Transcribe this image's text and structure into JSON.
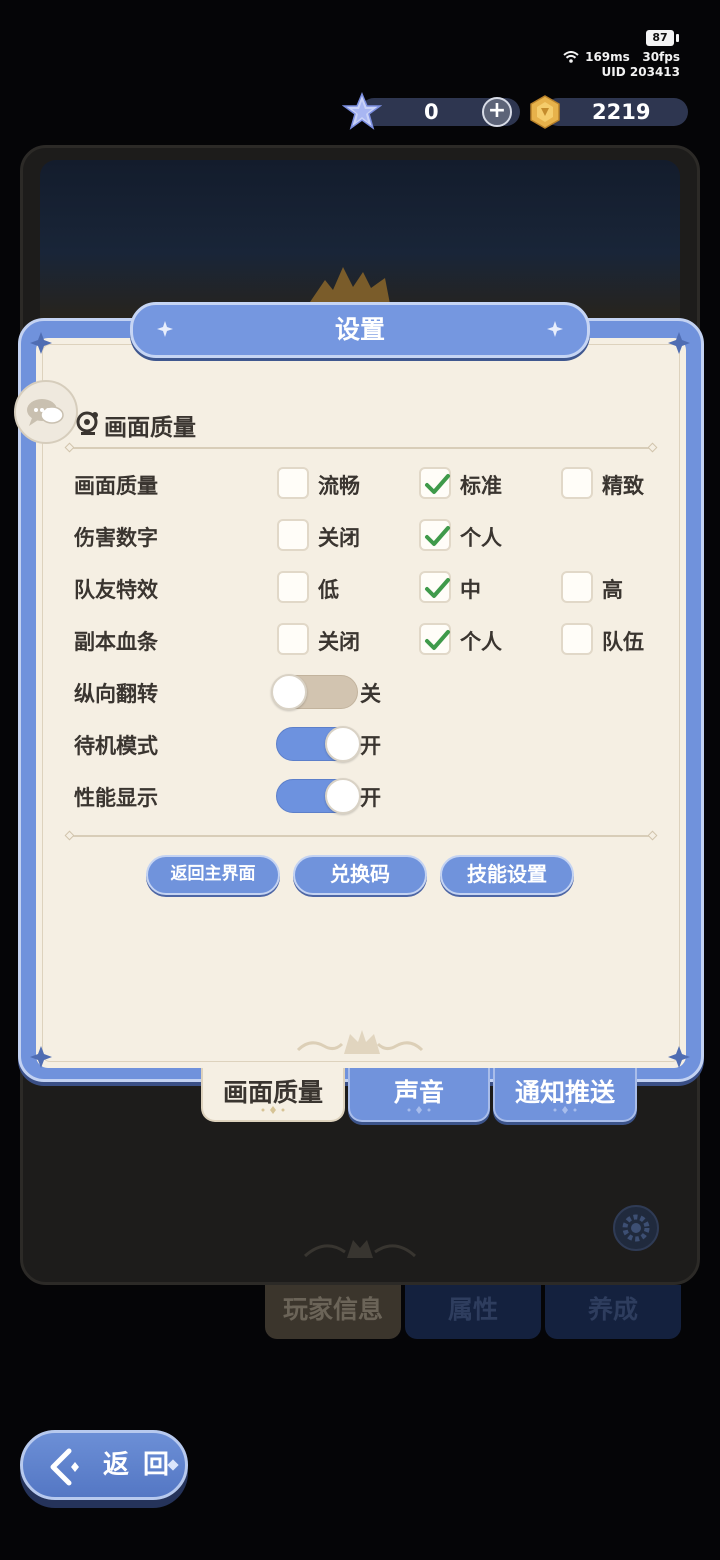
{
  "status": {
    "battery": "87",
    "ping": "169ms",
    "fps": "30fps",
    "uid": "UID 203413"
  },
  "currency": {
    "gems": "0",
    "coins": "2219"
  },
  "dialog": {
    "title": "设置",
    "section_title": "画面质量",
    "rows": [
      {
        "label": "画面质量",
        "options": [
          {
            "label": "流畅",
            "checked": false
          },
          {
            "label": "标准",
            "checked": true
          },
          {
            "label": "精致",
            "checked": false
          }
        ]
      },
      {
        "label": "伤害数字",
        "options": [
          {
            "label": "关闭",
            "checked": false
          },
          {
            "label": "个人",
            "checked": true
          }
        ]
      },
      {
        "label": "队友特效",
        "options": [
          {
            "label": "低",
            "checked": false
          },
          {
            "label": "中",
            "checked": true
          },
          {
            "label": "高",
            "checked": false
          }
        ]
      },
      {
        "label": "副本血条",
        "options": [
          {
            "label": "关闭",
            "checked": false
          },
          {
            "label": "个人",
            "checked": true
          },
          {
            "label": "队伍",
            "checked": false
          }
        ]
      }
    ],
    "toggles": [
      {
        "label": "纵向翻转",
        "state": "关",
        "on": false
      },
      {
        "label": "待机模式",
        "state": "开",
        "on": true
      },
      {
        "label": "性能显示",
        "state": "开",
        "on": true
      }
    ],
    "buttons": {
      "return_main": "返回主界面",
      "redeem_code": "兑换码",
      "skill_settings": "技能设置"
    },
    "tabs": [
      "画面质量",
      "声音",
      "通知推送"
    ]
  },
  "background": {
    "tabs": [
      "玩家信息",
      "属性",
      "养成"
    ]
  },
  "back_button": {
    "label": "返回"
  },
  "colors": {
    "accent_blue": "#7093dc",
    "panel_cream": "#f5efe3",
    "check_green": "#3f9a4a",
    "text_dark": "#3a3530"
  }
}
